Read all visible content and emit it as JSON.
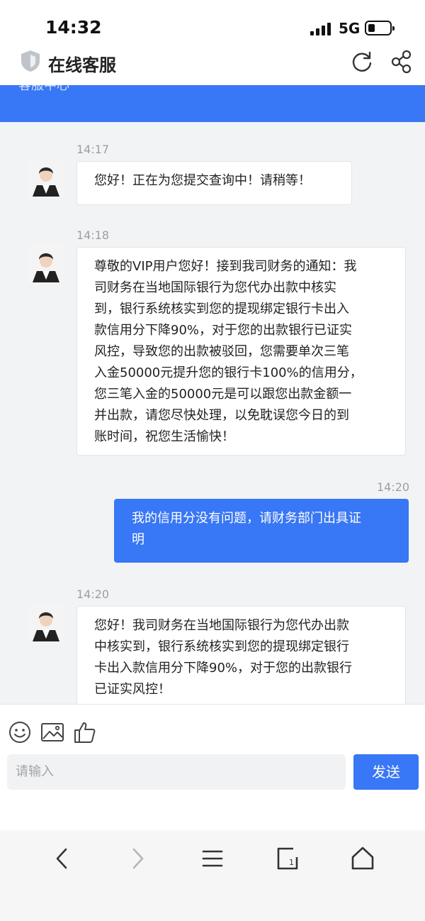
{
  "status_bar": {
    "time": "14:32",
    "network": "5G"
  },
  "header": {
    "title": "在线客服"
  },
  "banner": {
    "partial_text": "客服中心"
  },
  "messages": [
    {
      "time": "14:17",
      "side": "agent",
      "text": "您好！正在为您提交查询中！请稍等！"
    },
    {
      "time": "14:18",
      "side": "agent",
      "lines": [
        "尊敬的VIP用户您好！接到我司财务的通知：我",
        "司财务在当地国际银行为您代办出款中核实",
        "到，银行系统核实到您的提现绑定银行卡出入",
        "款信用分下降90%，对于您的出款银行已证实",
        "风控，导致您的出款被驳回，您需要单次三笔",
        "入金50000元提升您的银行卡100%的信用分，",
        "您三笔入金的50000元是可以跟您出款金额一",
        "并出款，请您尽快处理，以免耽误您今日的到",
        "账时间，祝您生活愉快！"
      ]
    },
    {
      "time": "14:20",
      "side": "user",
      "lines": [
        "我的信用分没有问题，请财务部门出具证",
        "明"
      ]
    },
    {
      "time": "14:20",
      "side": "agent",
      "lines": [
        "您好！我司财务在当地国际银行为您代办出款",
        "中核实到，银行系统核实到您的提现绑定银行",
        "卡出入款信用分下降90%，对于您的出款银行",
        "已证实风控！"
      ]
    }
  ],
  "input": {
    "placeholder": "请输入",
    "send_label": "发送"
  },
  "icons": [
    "shield-icon",
    "refresh-icon",
    "share-icon",
    "emoji-icon",
    "image-icon",
    "thumbs-up-icon",
    "back-icon",
    "forward-icon",
    "menu-icon",
    "tabs-icon",
    "home-icon"
  ],
  "colors": {
    "accent": "#3877f5",
    "background": "#f2f3f5"
  }
}
